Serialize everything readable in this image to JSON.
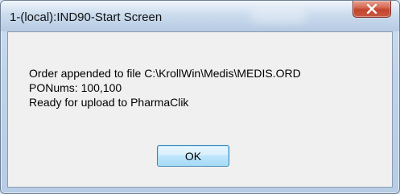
{
  "window": {
    "title": "1-(local):IND90-Start Screen",
    "close_icon": "close-icon"
  },
  "dialog": {
    "lines": [
      "Order appended to file C:\\KrollWin\\Medis\\MEDIS.ORD",
      "PONums: 100,100",
      "Ready for upload to PharmaClik"
    ],
    "ok_label": "OK"
  },
  "colors": {
    "close_button": "#c2452f",
    "ok_button_border": "#3c7fb1",
    "content_background": "#f0f0f0"
  }
}
